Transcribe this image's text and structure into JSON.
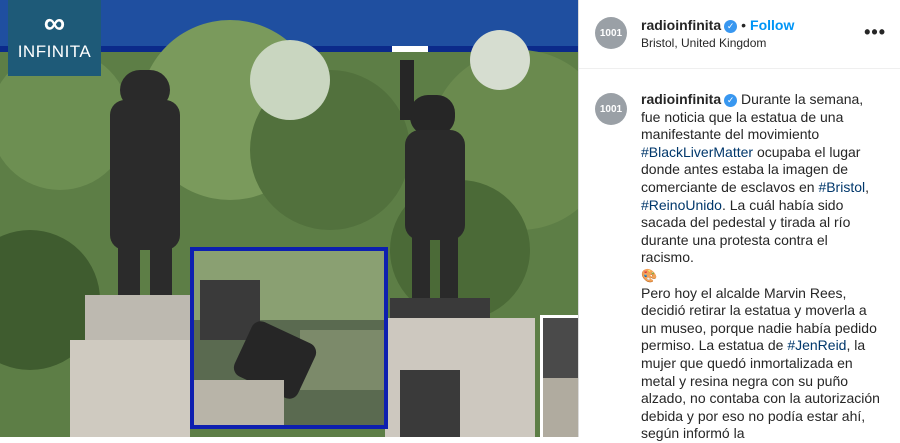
{
  "logo": {
    "symbol": "∞",
    "text": "INFINITA"
  },
  "post": {
    "username": "radioinfinita",
    "verified_icon": "verified-badge-icon",
    "dot": "•",
    "follow_label": "Follow",
    "location": "Bristol, United Kingdom",
    "more_icon": "•••",
    "avatar_text": "1001"
  },
  "caption": {
    "username": "radioinfinita",
    "p1": "Durante la semana, fue noticia que la estatua de una manifestante del movimiento",
    "tag1": "#BlackLiverMatter",
    "p2": "ocupaba el lugar donde antes estaba la imagen de comerciante de esclavos en",
    "tag2": "#Bristol",
    "sep": ",",
    "tag3": "#ReinoUnido",
    "p3": ". La cuál había sido sacada del pedestal y tirada al río durante una protesta contra el racismo.",
    "emoji": "🎨",
    "p4": "Pero hoy el alcalde Marvin Rees, decidió retirar la estatua y moverla a un museo, porque nadie había pedido permiso. La estatua de",
    "tag4": "#JenReid",
    "p5": ", la mujer que quedó inmortalizada en metal y resina negra con su puño alzado, no contaba con la autorización debida y por eso no podía estar ahí, según informó la"
  },
  "colors": {
    "accent": "#0095f6",
    "hashtag": "#00376b",
    "logo_bg": "#1e5a78"
  }
}
